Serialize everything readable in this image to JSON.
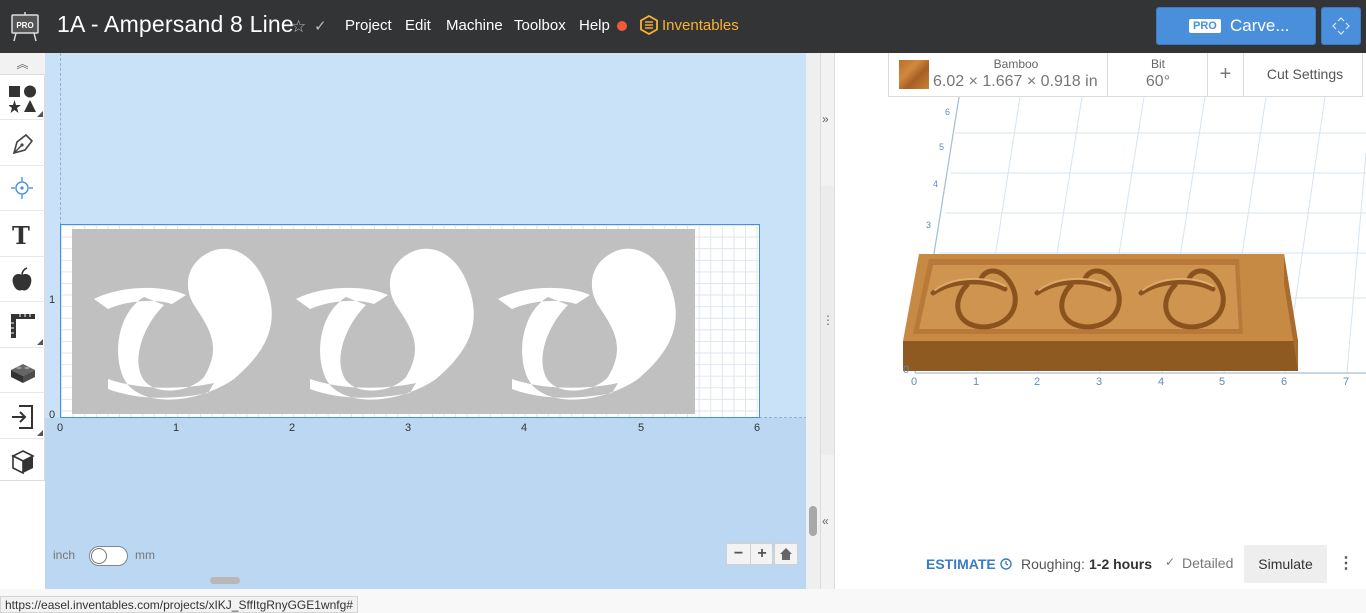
{
  "header": {
    "logo_badge": "PRO",
    "project_title": "1A - Ampersand 8 Line",
    "menus": [
      "Project",
      "Edit",
      "Machine",
      "Toolbox",
      "Help"
    ],
    "brand": "Inventables",
    "carve_badge": "PRO",
    "carve_label": "Carve..."
  },
  "left_toolbar": {
    "tools": [
      "shapes-icon",
      "pen-icon",
      "target-icon",
      "text-icon",
      "apple-icon",
      "ruler-icon",
      "lego-icon",
      "import-icon",
      "cube-icon"
    ]
  },
  "canvas": {
    "x_ticks": [
      "0",
      "1",
      "2",
      "3",
      "4",
      "5",
      "6"
    ],
    "y_ticks": [
      "1",
      "0"
    ],
    "unit_left": "inch",
    "unit_right": "mm",
    "unit_is_mm": false,
    "zoom_minus": "−",
    "zoom_plus": "+"
  },
  "material": {
    "name": "Bamboo",
    "dimensions": "6.02 × 1.667 × 0.918 in",
    "bit_label": "Bit",
    "bit_value": "60°",
    "add": "+",
    "cut_settings": "Cut Settings"
  },
  "preview": {
    "x_ticks": [
      "0",
      "1",
      "2",
      "3",
      "4",
      "5",
      "6",
      "7"
    ],
    "y_ticks": [
      "3",
      "4",
      "5",
      "6"
    ]
  },
  "estimate": {
    "label": "ESTIMATE",
    "roughing_label": "Roughing:",
    "roughing_value": "1-2 hours",
    "detailed_check": "✓",
    "detailed_label": "Detailed",
    "simulate": "Simulate",
    "more": "⋮"
  },
  "statusbar": {
    "url": "https://easel.inventables.com/projects/xIKJ_SffItgRnyGGE1wnfg#"
  },
  "colors": {
    "topbar": "#333435",
    "accent": "#4a8fdc",
    "brand": "#f9b231",
    "canvas": "#c9e2f8",
    "design": "#c0c0c0"
  }
}
